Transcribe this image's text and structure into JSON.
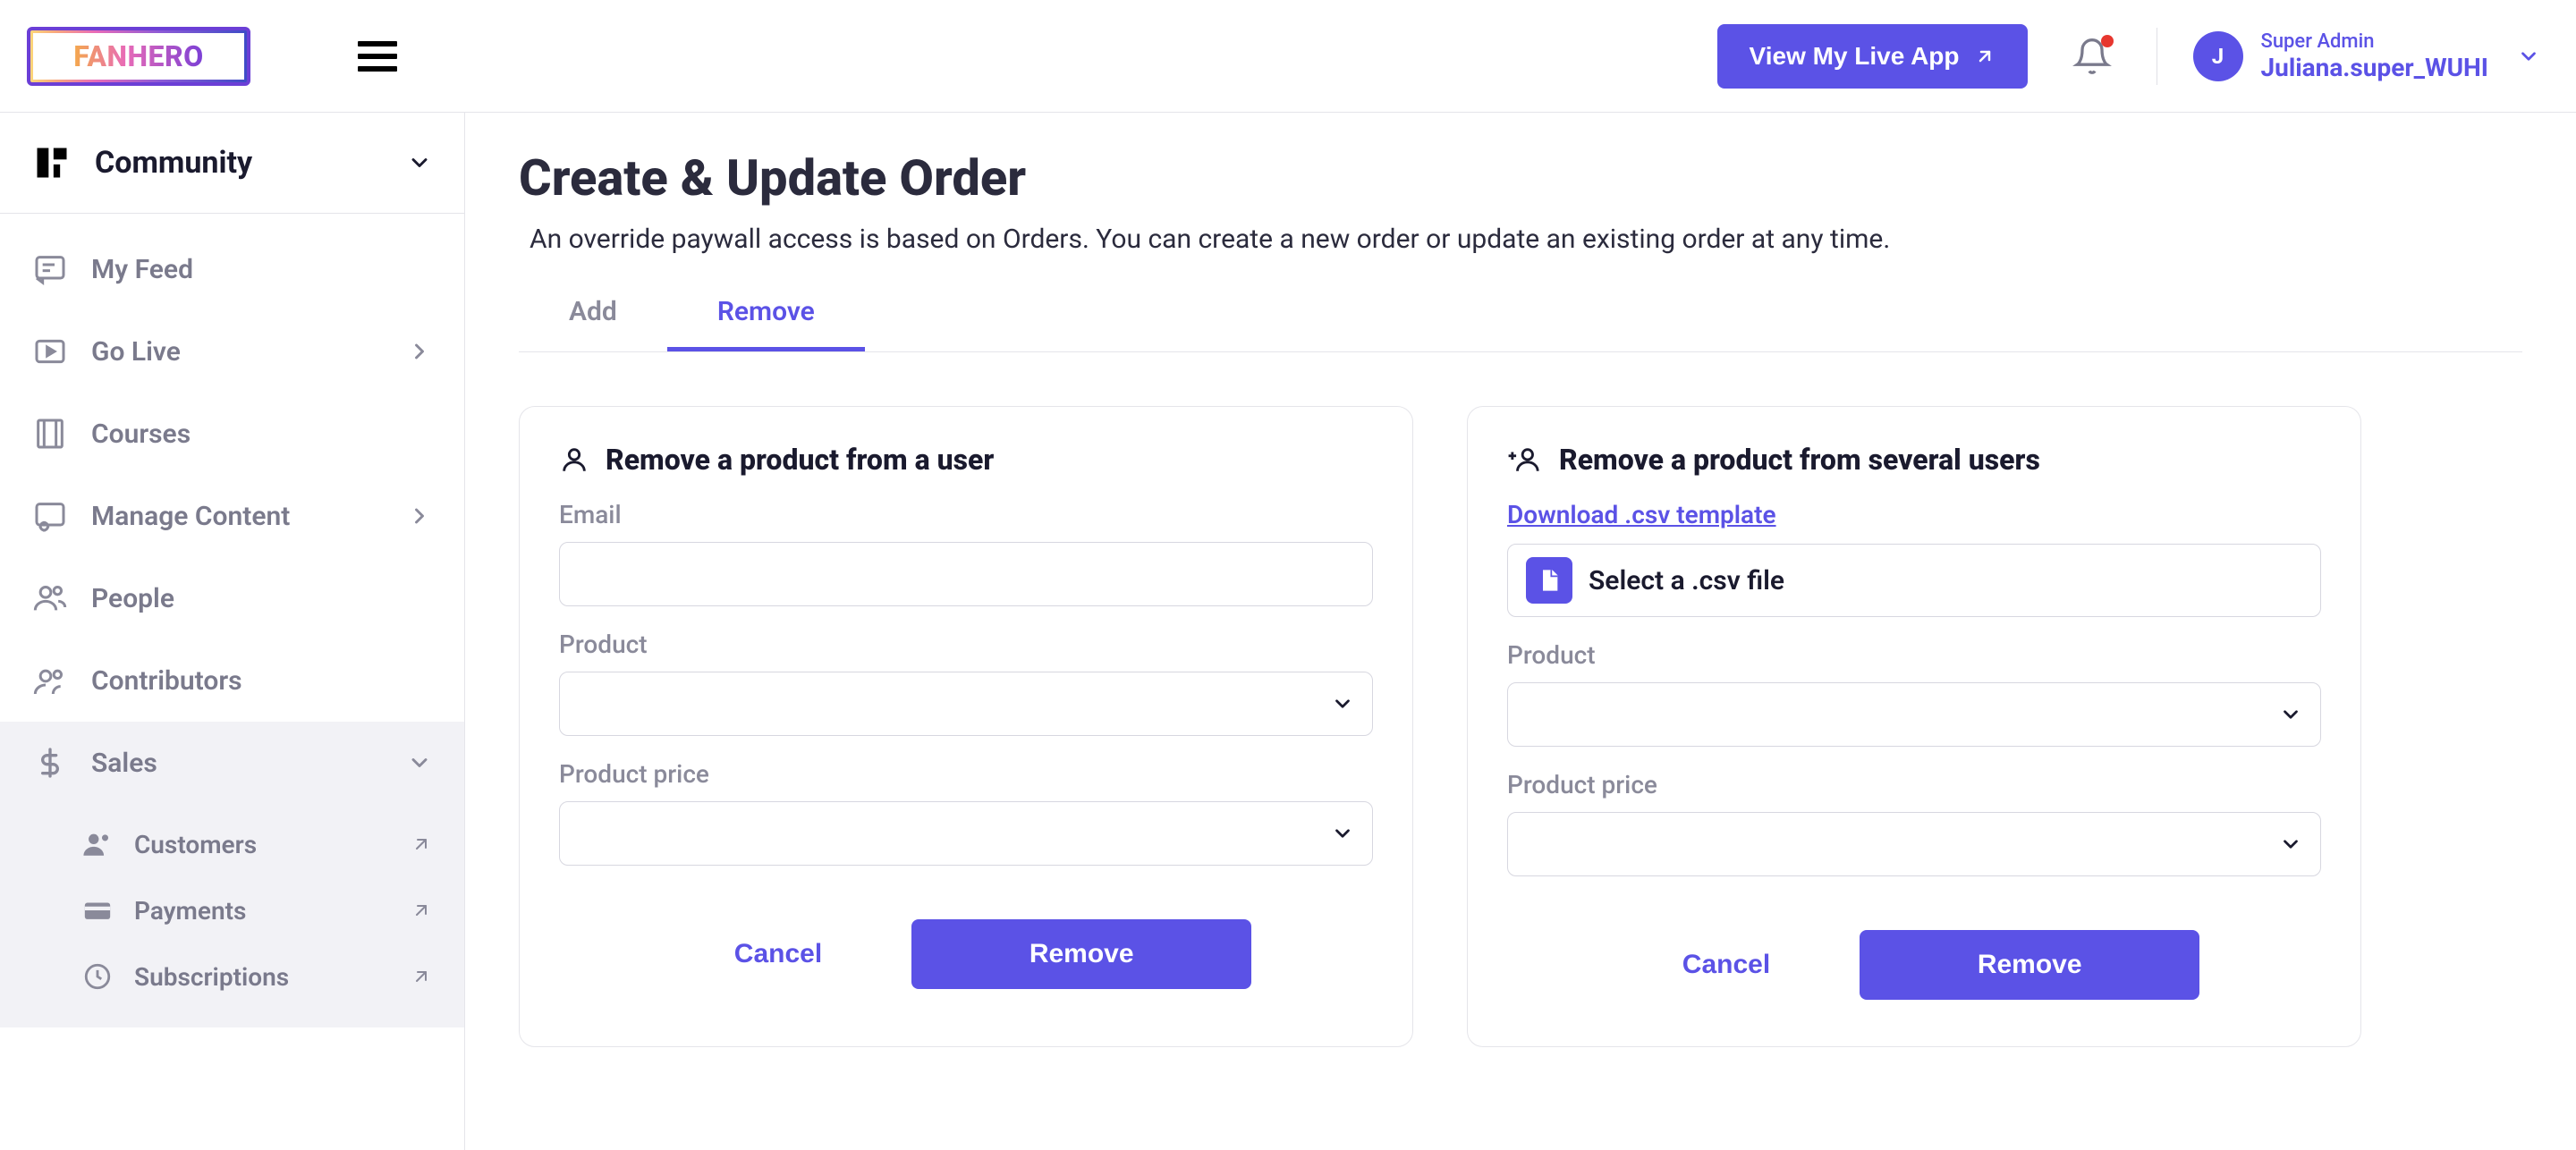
{
  "brand": {
    "name": "FANHERO"
  },
  "header": {
    "view_app_label": "View My Live App",
    "user": {
      "role": "Super Admin",
      "name": "Juliana.super_WUHI",
      "initial": "J"
    }
  },
  "sidebar": {
    "section": "Community",
    "items": [
      {
        "label": "My Feed"
      },
      {
        "label": "Go Live"
      },
      {
        "label": "Courses"
      },
      {
        "label": "Manage Content"
      },
      {
        "label": "People"
      },
      {
        "label": "Contributors"
      },
      {
        "label": "Sales"
      }
    ],
    "sales_sub": [
      {
        "label": "Customers"
      },
      {
        "label": "Payments"
      },
      {
        "label": "Subscriptions"
      }
    ]
  },
  "page": {
    "title": "Create & Update Order",
    "description": "An override paywall access is based on Orders. You can create a new order or update an existing order at any time.",
    "tabs": {
      "add": "Add",
      "remove": "Remove",
      "active": "remove"
    }
  },
  "card_single": {
    "title": "Remove a product from a user",
    "email_label": "Email",
    "email_value": "",
    "product_label": "Product",
    "product_value": "",
    "price_label": "Product price",
    "price_value": "",
    "cancel": "Cancel",
    "submit": "Remove"
  },
  "card_multi": {
    "title": "Remove a product from several users",
    "download_link": "Download .csv template",
    "file_label": "Select a .csv file",
    "product_label": "Product",
    "product_value": "",
    "price_label": "Product price",
    "price_value": "",
    "cancel": "Cancel",
    "submit": "Remove"
  },
  "colors": {
    "accent": "#5b52e6"
  }
}
